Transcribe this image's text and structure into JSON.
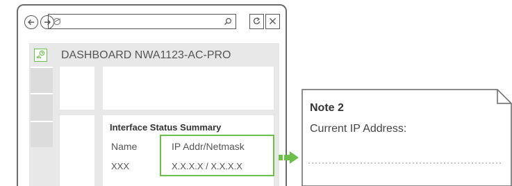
{
  "browser": {
    "icons": [
      "back-icon",
      "forward-icon",
      "browser-icon",
      "search-icon",
      "refresh-icon",
      "close-icon"
    ]
  },
  "dashboard": {
    "title": "DASHBOARD  NWA1123-AC-PRO"
  },
  "summary": {
    "title": "Interface Status Summary",
    "columns": [
      "Name",
      "IP Addr/Netmask"
    ],
    "row": [
      "XXX",
      "X.X.X.X / X.X.X.X"
    ]
  },
  "note": {
    "title": "Note 2",
    "label": "Current IP Address:"
  },
  "colors": {
    "accent": "#6bbf4b",
    "border": "#6a6a6a",
    "panel_bg": "#e8e8e8"
  }
}
